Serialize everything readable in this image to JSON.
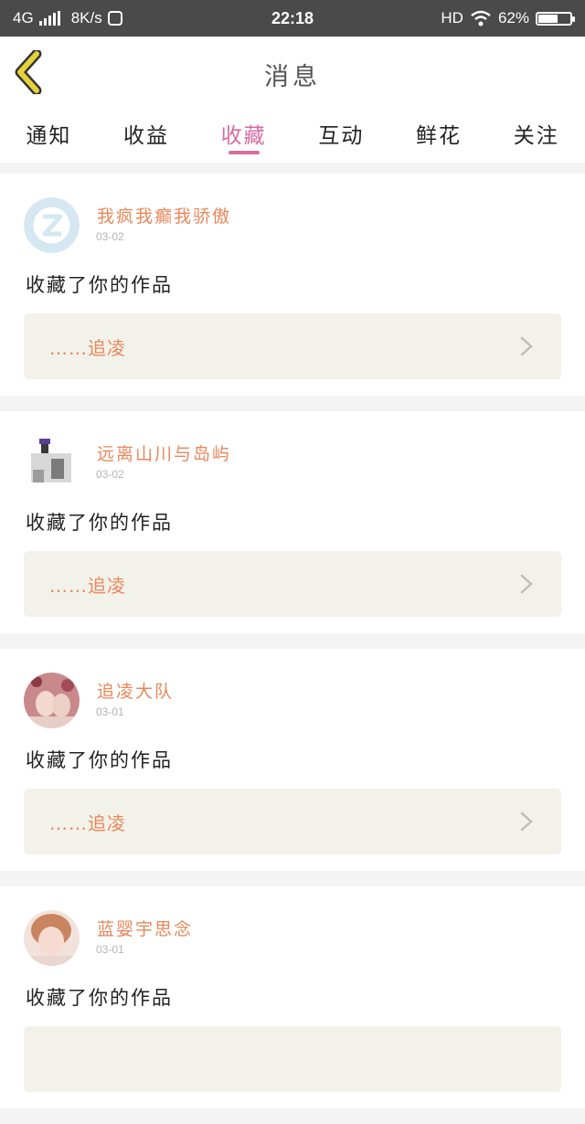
{
  "status_bar": {
    "network": "4G",
    "speed": "8K/s",
    "time": "22:18",
    "hd": "HD",
    "battery": "62%",
    "battery_level": 0.62
  },
  "nav": {
    "title": "消息"
  },
  "tabs": [
    {
      "label": "通知",
      "active": false
    },
    {
      "label": "收益",
      "active": false
    },
    {
      "label": "收藏",
      "active": true
    },
    {
      "label": "互动",
      "active": false
    },
    {
      "label": "鲜花",
      "active": false
    },
    {
      "label": "关注",
      "active": false
    }
  ],
  "items": [
    {
      "user": "我疯我癫我骄傲",
      "date": "03-02",
      "action": "收藏了你的作品",
      "work": "……追凌"
    },
    {
      "user": "远离山川与岛屿",
      "date": "03-02",
      "action": "收藏了你的作品",
      "work": "……追凌"
    },
    {
      "user": "追凌大队",
      "date": "03-01",
      "action": "收藏了你的作品",
      "work": "……追凌"
    },
    {
      "user": "蓝婴宇思念",
      "date": "03-01",
      "action": "收藏了你的作品",
      "work": ""
    }
  ],
  "colors": {
    "accent": "#d86ca1",
    "username": "#e8875a",
    "back_arrow": "#e3d23a"
  }
}
